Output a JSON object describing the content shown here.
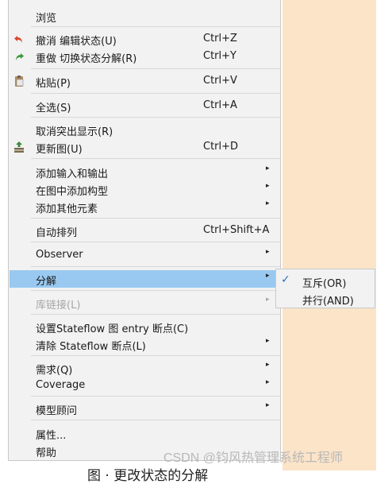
{
  "menu": {
    "browse": "浏览",
    "undo": {
      "label": "撤消 编辑状态(U)",
      "accel": "Ctrl+Z"
    },
    "redo": {
      "label": "重做 切换状态分解(R)",
      "accel": "Ctrl+Y"
    },
    "paste": {
      "label": "粘贴(P)",
      "accel": "Ctrl+V"
    },
    "select_all": {
      "label": "全选(S)",
      "accel": "Ctrl+A"
    },
    "unhighlight": {
      "label": "取消突出显示(R)"
    },
    "update_diagram": {
      "label": "更新图(U)",
      "accel": "Ctrl+D"
    },
    "add_io": "添加输入和输出",
    "add_construct": "在图中添加构型",
    "add_other": "添加其他元素",
    "auto_arrange": {
      "label": "自动排列",
      "accel": "Ctrl+Shift+A"
    },
    "observer": "Observer",
    "decompose": "分解",
    "library_link": "库链接(L)",
    "set_entry_bp": "设置Stateflow 图 entry 断点(C)",
    "clear_bp": "清除 Stateflow 断点(L)",
    "requirements": "需求(Q)",
    "coverage": "Coverage",
    "model_advisor": "模型顾问",
    "properties": "属性...",
    "help": "帮助"
  },
  "submenu": {
    "exclusive": "互斥(OR)",
    "parallel": "并行(AND)",
    "checked": "exclusive"
  },
  "icons": {
    "undo": "undo-arrow-icon",
    "redo": "redo-arrow-icon",
    "paste": "clipboard-icon",
    "update": "update-diagram-icon",
    "submenu_arrow": "▸",
    "check": "✓"
  },
  "watermark": "CSDN @钧风热管理系统工程师",
  "caption": "图 · 更改状态的分解"
}
